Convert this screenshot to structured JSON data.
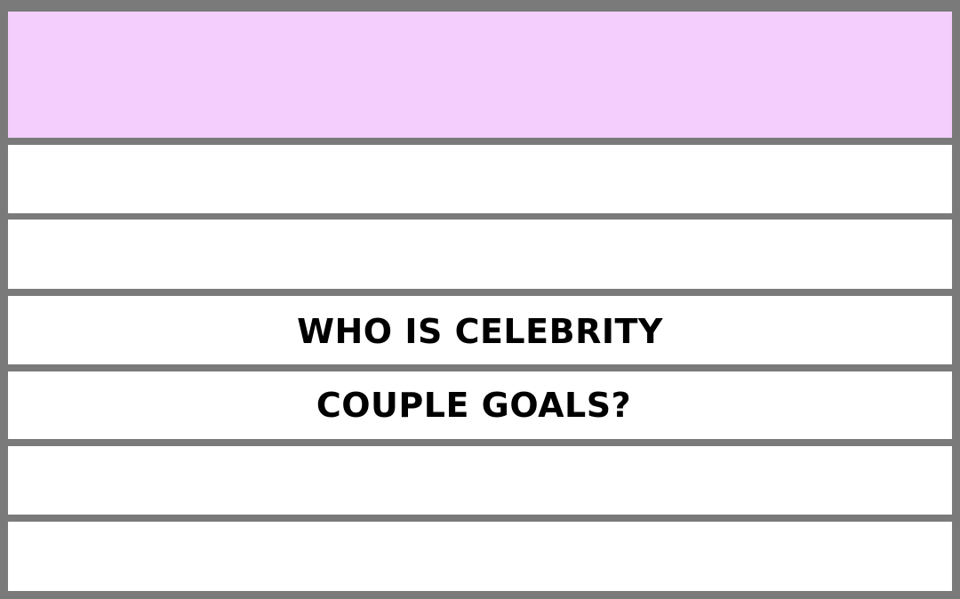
{
  "colors": {
    "frame": "#7a7a7a",
    "header_band": "#f4cffe",
    "row_background": "#ffffff",
    "text": "#000000"
  },
  "title_lines": [
    "WHO IS CELEBRITY",
    "COUPLE GOALS?"
  ]
}
